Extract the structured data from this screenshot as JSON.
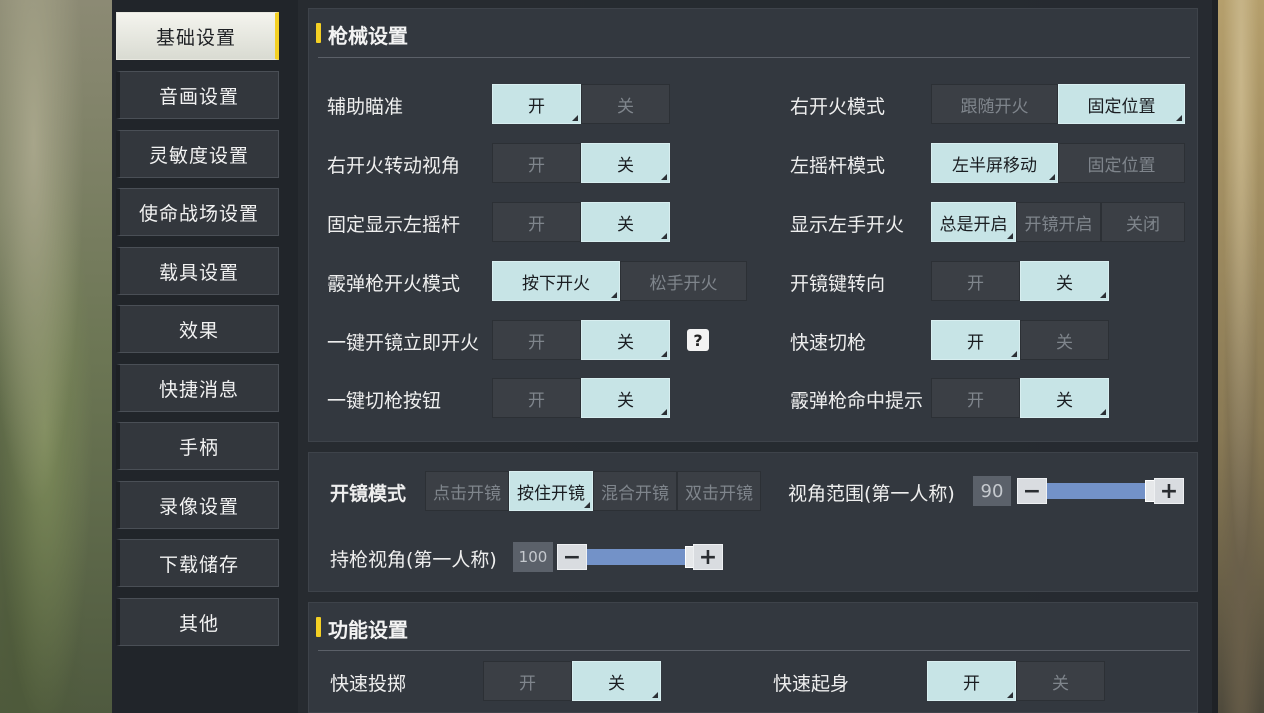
{
  "sidebar": {
    "items": [
      {
        "label": "基础设置",
        "active": true
      },
      {
        "label": "音画设置"
      },
      {
        "label": "灵敏度设置"
      },
      {
        "label": "使命战场设置"
      },
      {
        "label": "载具设置"
      },
      {
        "label": "效果"
      },
      {
        "label": "快捷消息"
      },
      {
        "label": "手柄"
      },
      {
        "label": "录像设置"
      },
      {
        "label": "下载储存"
      },
      {
        "label": "其他"
      }
    ]
  },
  "gun_settings": {
    "title": "枪械设置",
    "left": [
      {
        "label": "辅助瞄准",
        "options": [
          "开",
          "关"
        ],
        "selected": 0
      },
      {
        "label": "右开火转动视角",
        "options": [
          "开",
          "关"
        ],
        "selected": 1
      },
      {
        "label": "固定显示左摇杆",
        "options": [
          "开",
          "关"
        ],
        "selected": 1
      },
      {
        "label": "霰弹枪开火模式",
        "options": [
          "按下开火",
          "松手开火"
        ],
        "selected": 0
      },
      {
        "label": "一键开镜立即开火",
        "options": [
          "开",
          "关"
        ],
        "selected": 1,
        "help": "?"
      },
      {
        "label": "一键切枪按钮",
        "options": [
          "开",
          "关"
        ],
        "selected": 1
      }
    ],
    "right": [
      {
        "label": "右开火模式",
        "options": [
          "跟随开火",
          "固定位置"
        ],
        "selected": 1
      },
      {
        "label": "左摇杆模式",
        "options": [
          "左半屏移动",
          "固定位置"
        ],
        "selected": 0
      },
      {
        "label": "显示左手开火",
        "options": [
          "总是开启",
          "开镜开启",
          "关闭"
        ],
        "selected": 0
      },
      {
        "label": "开镜键转向",
        "options": [
          "开",
          "关"
        ],
        "selected": 1
      },
      {
        "label": "快速切枪",
        "options": [
          "开",
          "关"
        ],
        "selected": 0
      },
      {
        "label": "霰弹枪命中提示",
        "options": [
          "开",
          "关"
        ],
        "selected": 1
      }
    ]
  },
  "scope": {
    "mode_label": "开镜模式",
    "mode_options": [
      "点击开镜",
      "按住开镜",
      "混合开镜",
      "双击开镜"
    ],
    "mode_selected": 1,
    "fov_label": "视角范围(第一人称)",
    "fov_value": "90",
    "fov_level": 1.0,
    "hold_label": "持枪视角(第一人称)",
    "hold_value": "100",
    "hold_level": 1.0,
    "minus": "−",
    "plus": "+"
  },
  "function_settings": {
    "title": "功能设置",
    "rows": [
      {
        "label": "快速投掷",
        "options": [
          "开",
          "关"
        ],
        "selected": 1
      },
      {
        "label": "快速起身",
        "options": [
          "开",
          "关"
        ],
        "selected": 0
      }
    ]
  },
  "colors": {
    "accent_yellow": "#f4d024",
    "selected_option": "#c7e4e6",
    "slider_fill": "#7392c8"
  }
}
